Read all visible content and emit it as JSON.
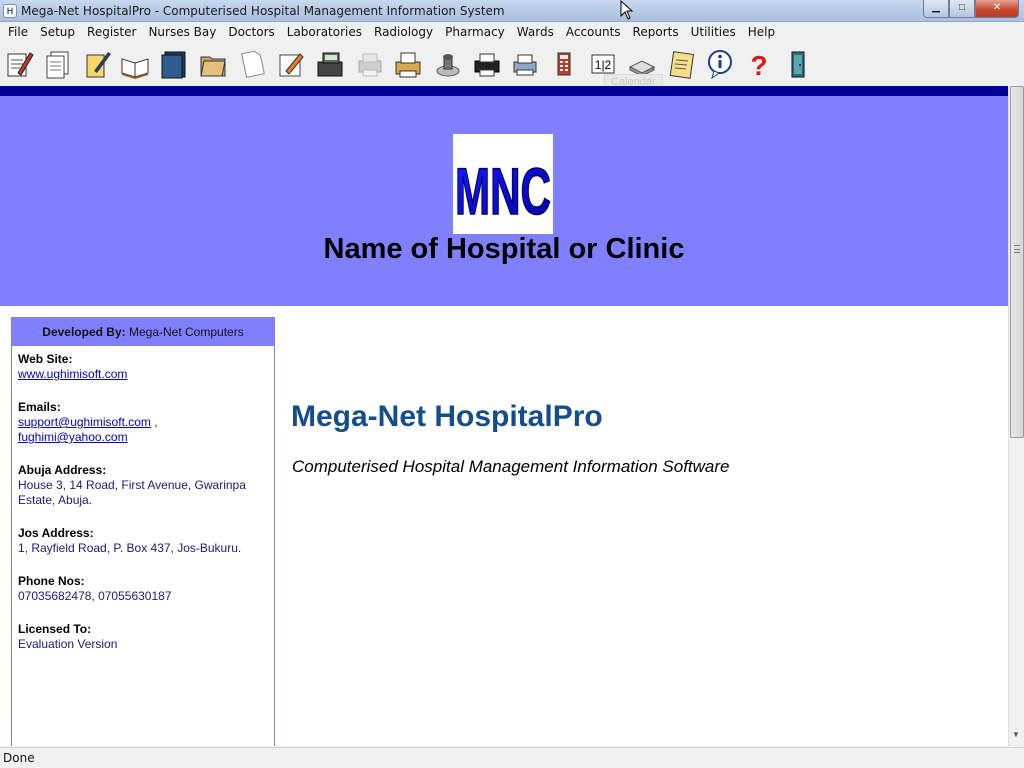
{
  "window": {
    "title": "Mega-Net HospitalPro - Computerised Hospital Management Information System",
    "minimize": "▁",
    "maximize": "□",
    "close": "✕"
  },
  "menu": [
    "File",
    "Setup",
    "Register",
    "Nurses Bay",
    "Doctors",
    "Laboratories",
    "Radiology",
    "Pharmacy",
    "Wards",
    "Accounts",
    "Reports",
    "Utilities",
    "Help"
  ],
  "toolbar": {
    "icons": [
      "edit-record-icon",
      "documents-icon",
      "notepad-pen-icon",
      "open-book-icon",
      "folder-icon",
      "folders-icon",
      "blank-page-icon",
      "note-pencil-icon",
      "cash-register-icon",
      "printer-disabled-icon",
      "fax-printer-icon",
      "stamp-icon",
      "printer-icon",
      "scanner-printer-icon",
      "calculator-icon",
      "number-12-icon",
      "calendar-device-icon",
      "notepad-icon",
      "info-icon",
      "help-question-icon",
      "exit-door-icon"
    ],
    "tooltip": "Calendar"
  },
  "header": {
    "logo_text": "MNC",
    "hospital_name": "Name of Hospital or Clinic"
  },
  "sidebar": {
    "developed_by_label": "Developed By:",
    "developed_by_value": "Mega-Net Computers",
    "website_label": "Web Site:",
    "website": "www.ughimisoft.com",
    "emails_label": "Emails:",
    "email1": "support@ughimisoft.com",
    "email_sep": " ,",
    "email2": "fughimi@yahoo.com",
    "abuja_label": "Abuja Address:",
    "abuja_address": "House 3, 14 Road, First Avenue, Gwarinpa Estate, Abuja.",
    "jos_label": "Jos Address:",
    "jos_address": "1, Rayfield Road, P. Box 437, Jos-Bukuru.",
    "phone_label": "Phone Nos:",
    "phones": "07035682478, 07055630187",
    "licensed_label": "Licensed To:",
    "licensed_value": "Evaluation Version"
  },
  "main": {
    "product_title": "Mega-Net HospitalPro",
    "product_subtitle": "Computerised Hospital Management Information Software"
  },
  "status": {
    "text": "Done"
  },
  "colors": {
    "header_band": "#8080ff",
    "header_topline": "#000099",
    "product_title": "#134d8c",
    "logo_letters": "#0000cc"
  }
}
